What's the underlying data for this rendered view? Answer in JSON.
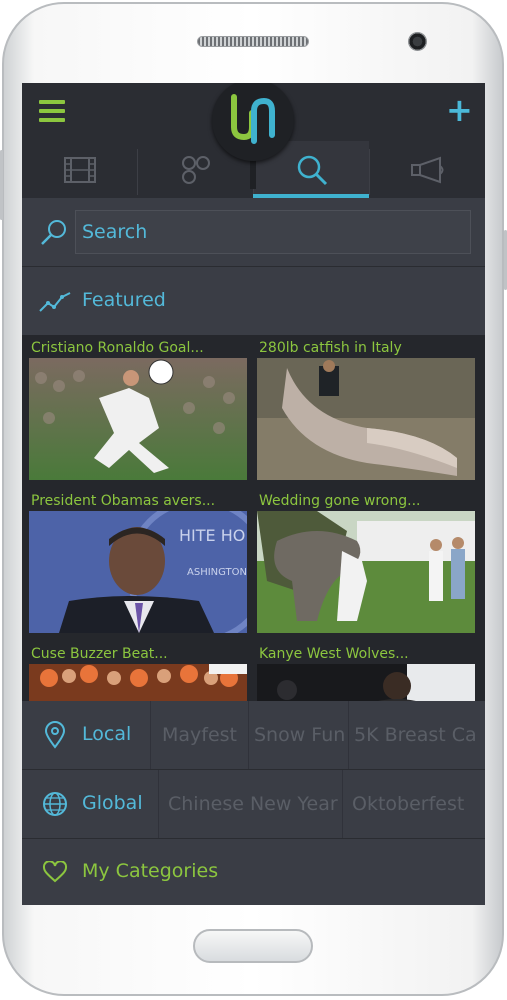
{
  "tabs": [
    {
      "name": "film-icon",
      "selected": false
    },
    {
      "name": "bubbles-icon",
      "selected": false
    },
    {
      "name": "search-icon",
      "selected": true
    },
    {
      "name": "megaphone-icon",
      "selected": false
    }
  ],
  "search": {
    "placeholder": "Search"
  },
  "featured": {
    "label": "Featured",
    "items": [
      {
        "title": "Cristiano Ronaldo Goal..."
      },
      {
        "title": "280lb catfish in Italy"
      },
      {
        "title": "President Obamas avers..."
      },
      {
        "title": "Wedding gone wrong..."
      },
      {
        "title": "Cuse Buzzer Beat..."
      },
      {
        "title": "Kanye West Wolves..."
      }
    ]
  },
  "local": {
    "label": "Local",
    "items": [
      "Mayfest",
      "Snow Fun",
      "5K Breast Ca"
    ]
  },
  "global": {
    "label": "Global",
    "items": [
      "Chinese New Year",
      "Oktoberfest"
    ]
  },
  "my_categories": {
    "label": "My Categories"
  },
  "colors": {
    "accent_blue": "#53b9d9",
    "accent_green": "#8cc63f",
    "background": "#25272c"
  }
}
